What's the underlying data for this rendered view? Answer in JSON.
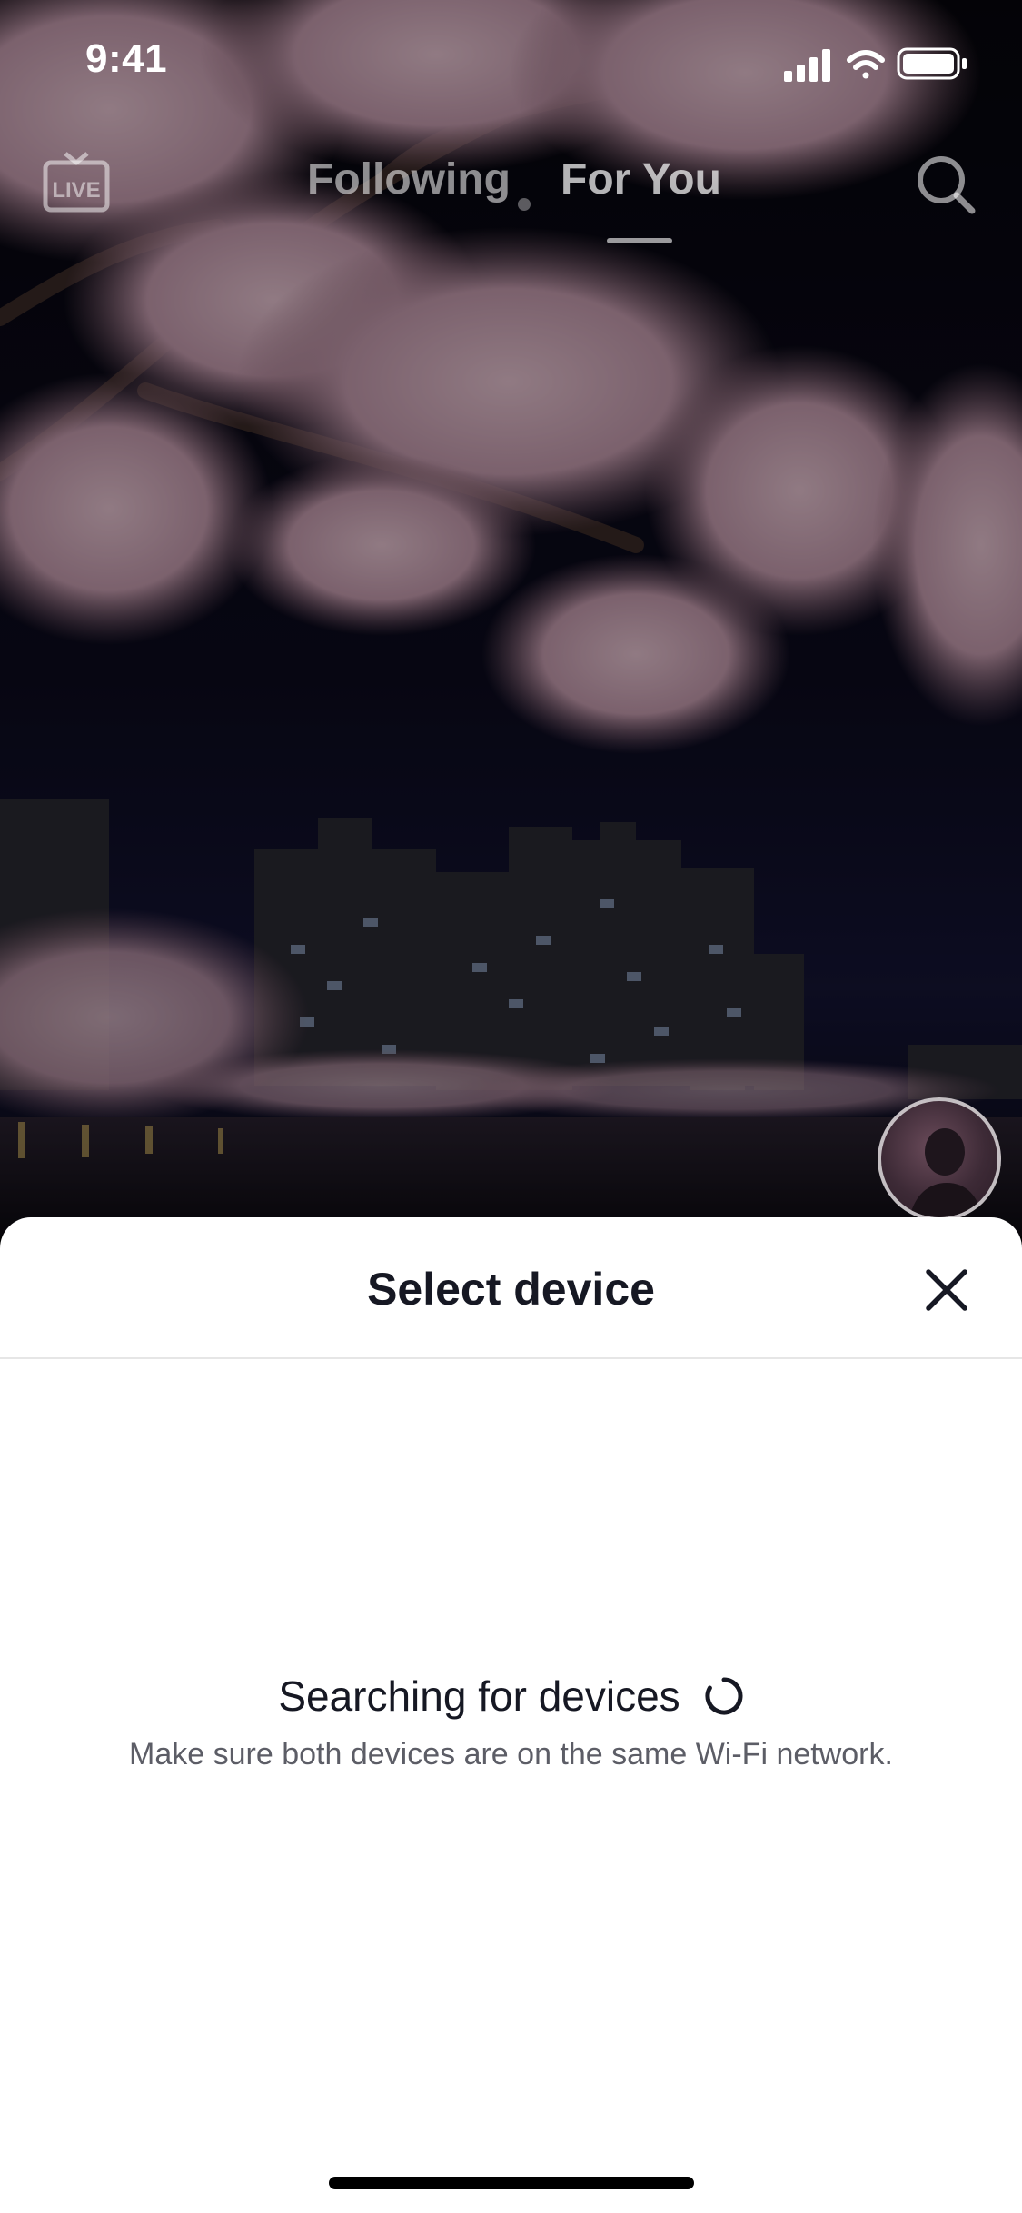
{
  "status_bar": {
    "time": "9:41"
  },
  "top_nav": {
    "live_label": "LIVE",
    "tabs": [
      {
        "label": "Following",
        "active": false
      },
      {
        "label": "For You",
        "active": true
      }
    ]
  },
  "sheet": {
    "title": "Select device",
    "status_text": "Searching for devices",
    "hint": "Make sure both devices are on the same Wi-Fi network."
  },
  "colors": {
    "sheet_background": "#ffffff",
    "title_text": "#161823",
    "hint_text": "#5c5d66",
    "divider": "#e6e6e6"
  },
  "icons": [
    "live-icon",
    "search-icon",
    "close-icon",
    "spinner-icon",
    "signal-icon",
    "wifi-icon",
    "battery-icon"
  ]
}
